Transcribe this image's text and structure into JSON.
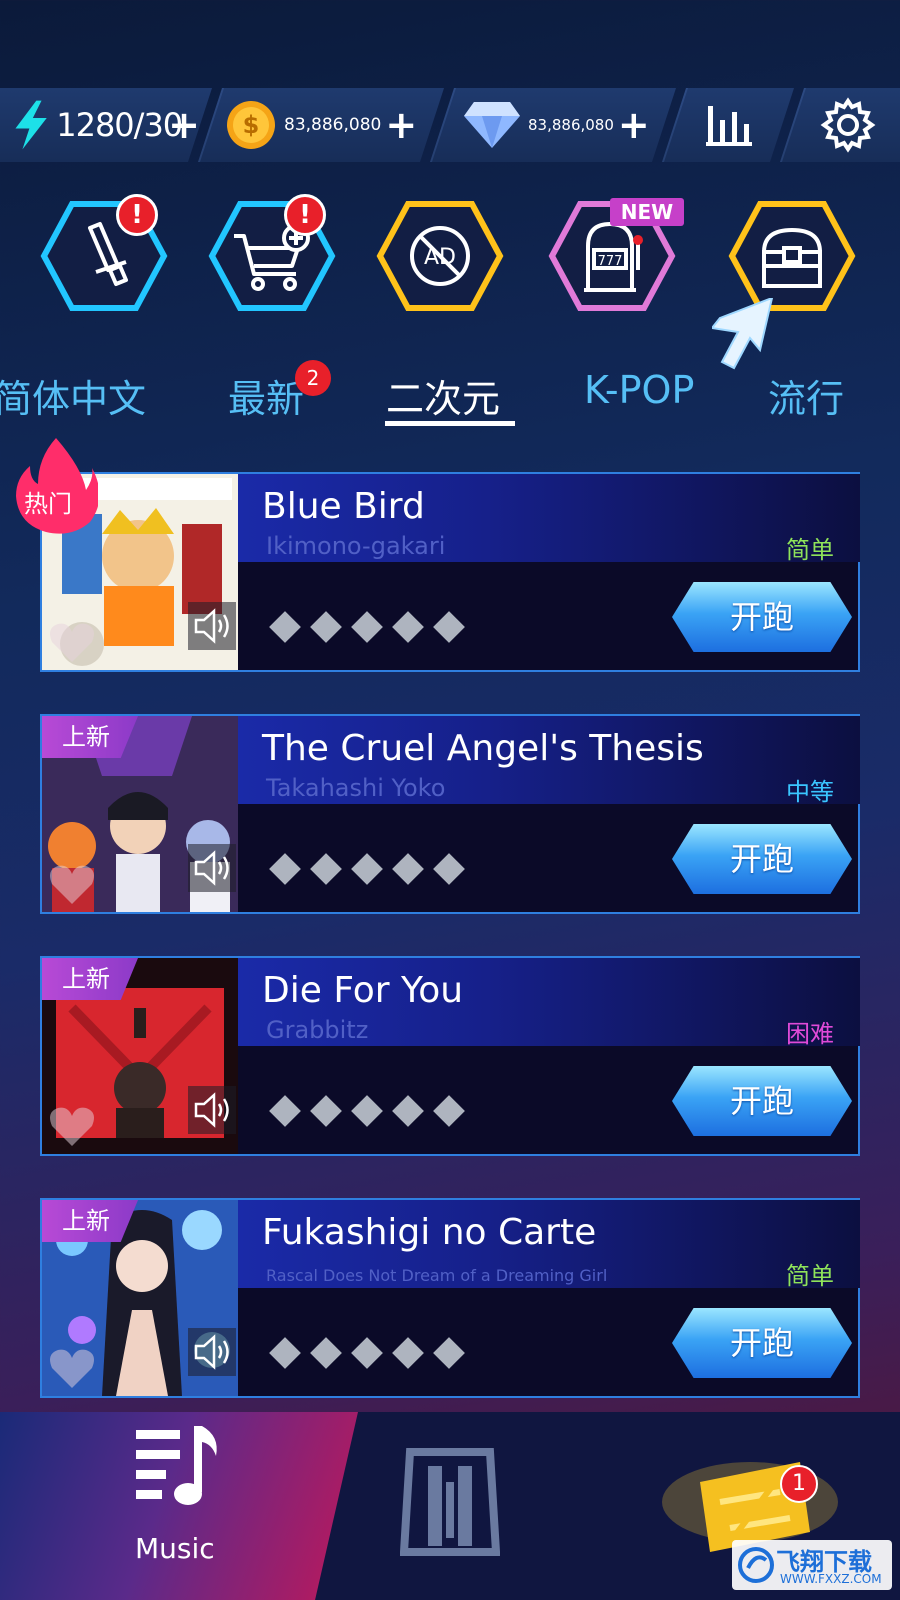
{
  "currency": {
    "energy": "1280/30",
    "coins": "83,886,080",
    "gems": "83,886,080",
    "plus_label": "+"
  },
  "features": [
    {
      "icon": "sword-icon",
      "badge": "!",
      "glow": "#22c6ff"
    },
    {
      "icon": "cart-add-icon",
      "badge": "!",
      "glow": "#22c6ff"
    },
    {
      "icon": "no-ads-icon",
      "badge": "",
      "glow": "#ffc21a"
    },
    {
      "icon": "slot-machine-icon",
      "badge": "NEW",
      "glow": "#e07ad8"
    },
    {
      "icon": "treasure-chest-icon",
      "badge": "",
      "glow": "#ffc21a"
    }
  ],
  "tabs": [
    {
      "label": "简体中文",
      "active": false
    },
    {
      "label": "最新",
      "active": false,
      "badge": "2"
    },
    {
      "label": "二次元",
      "active": true
    },
    {
      "label": "K-POP",
      "active": false
    },
    {
      "label": "流行",
      "active": false
    }
  ],
  "songs": [
    {
      "title": "Blue Bird",
      "artist": "Ikimono-gakari",
      "difficulty": "简单",
      "difficulty_color": "#8fe35a",
      "tag": "热门",
      "run_label": "开跑",
      "stars": 5
    },
    {
      "title": "The Cruel Angel's Thesis",
      "artist": "Takahashi Yoko",
      "difficulty": "中等",
      "difficulty_color": "#3ac6ff",
      "tag": "上新",
      "run_label": "开跑",
      "stars": 5
    },
    {
      "title": "Die For You",
      "artist": "Grabbitz",
      "difficulty": "困难",
      "difficulty_color": "#e04ad8",
      "tag": "上新",
      "run_label": "开跑",
      "stars": 5
    },
    {
      "title": "Fukashigi no Carte",
      "artist": "Rascal Does Not Dream of a Dreaming Girl",
      "difficulty": "简单",
      "difficulty_color": "#8fe35a",
      "tag": "上新",
      "run_label": "开跑",
      "stars": 5
    }
  ],
  "bottom_nav": {
    "music_label": "Music",
    "rewards_badge": "1"
  },
  "watermark": {
    "main": "飞翔下载",
    "sub": "WWW.FXXZ.COM"
  }
}
